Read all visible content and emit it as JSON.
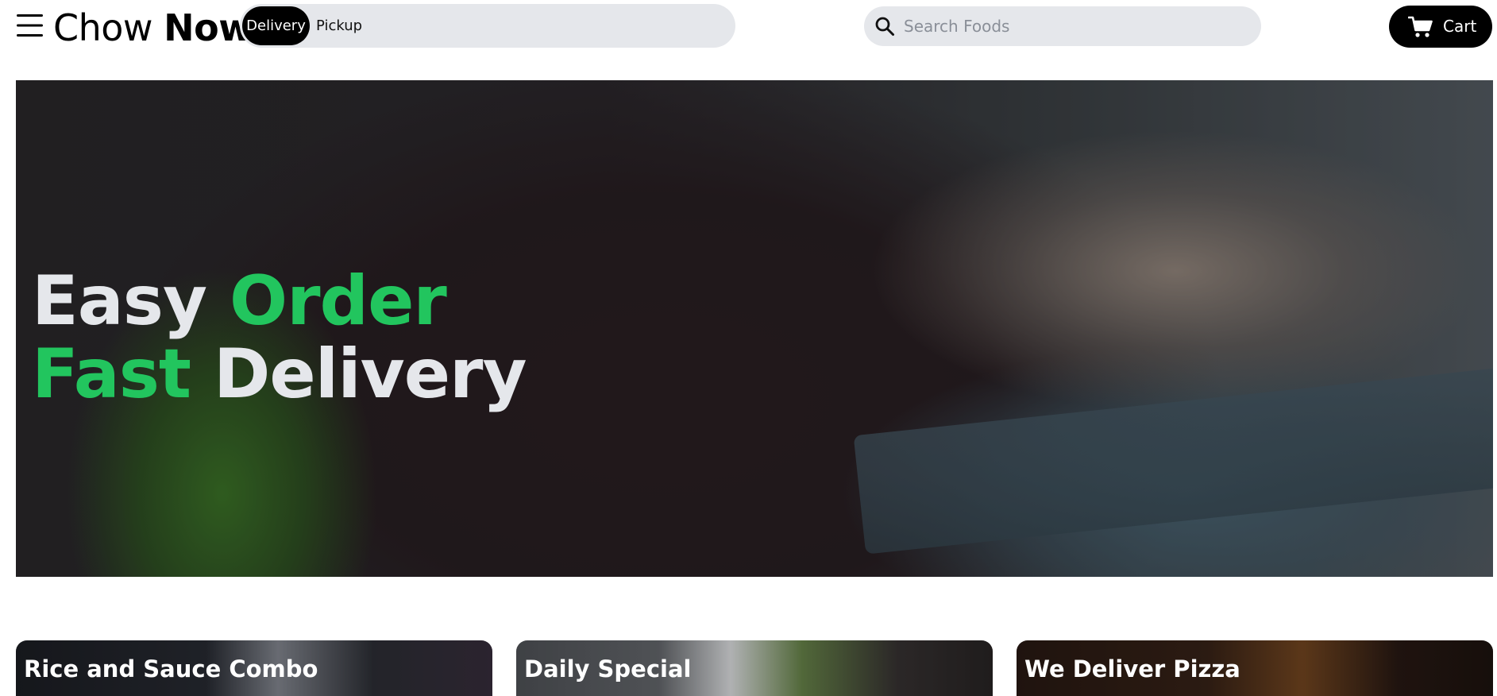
{
  "header": {
    "menu_icon": "hamburger-menu-icon",
    "logo": {
      "light": "Chow",
      "bold": "Now"
    },
    "mode_toggle": {
      "active": "Delivery",
      "inactive": "Pickup"
    },
    "search": {
      "placeholder": "Search Foods",
      "value": "",
      "icon": "search-icon"
    },
    "cart": {
      "label": "Cart",
      "icon": "cart-icon"
    }
  },
  "hero": {
    "line1": {
      "word1": "Easy",
      "word2": "Order"
    },
    "line2": {
      "word1": "Fast",
      "word2": "Delivery"
    },
    "accent_color": "#22c55e"
  },
  "cards": [
    {
      "title": "Rice and Sauce Combo"
    },
    {
      "title": "Daily Special"
    },
    {
      "title": "We Deliver Pizza"
    }
  ]
}
